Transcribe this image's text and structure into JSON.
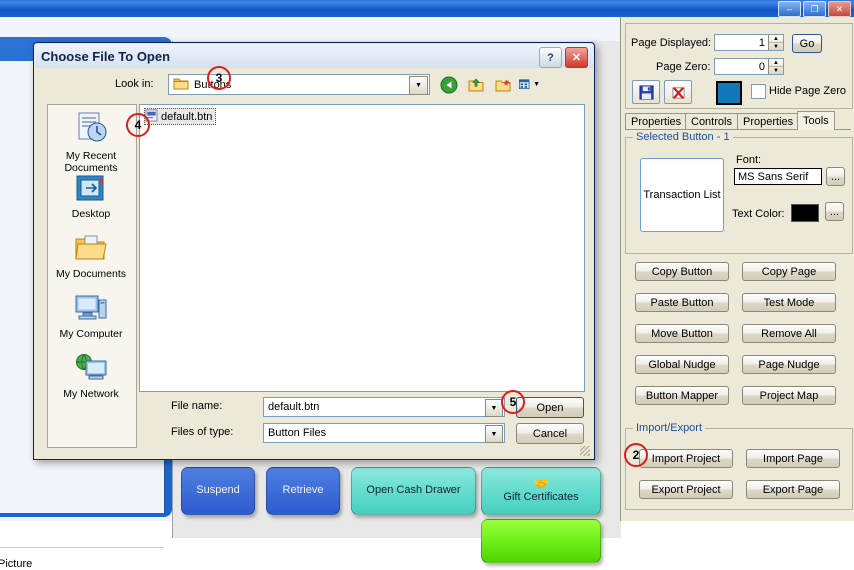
{
  "background_window": {
    "picture_label": "Picture",
    "window_buttons": [
      {
        "name": "minimize",
        "glyph": "–"
      },
      {
        "name": "maximize",
        "glyph": "❐"
      },
      {
        "name": "close",
        "glyph": "✕"
      }
    ],
    "pos_buttons": [
      {
        "label": "Suspend",
        "color": "blue"
      },
      {
        "label": "Retrieve",
        "color": "blue"
      },
      {
        "label": "Open Cash Drawer",
        "color": "teal"
      },
      {
        "label": "Gift Certificates",
        "color": "teal",
        "icon": "🤝"
      },
      {
        "label": "",
        "color": "green"
      }
    ]
  },
  "right_panel": {
    "page_displayed_label": "Page Displayed:",
    "page_displayed_value": "1",
    "page_zero_label": "Page Zero:",
    "page_zero_value": "0",
    "go_label": "Go",
    "save_icon": "💾",
    "delete_icon": "✖",
    "page_color": "#1378b8",
    "hide_page_zero_label": "Hide Page Zero",
    "hide_page_zero_checked": false,
    "tabs": [
      {
        "label": "Properties",
        "active": false
      },
      {
        "label": "Controls",
        "active": false
      },
      {
        "label": "Properties",
        "active": false
      },
      {
        "label": "Tools",
        "active": true
      }
    ],
    "selected_button_group": {
      "title": "Selected Button - 1",
      "preview_label": "Transaction List",
      "font_label": "Font:",
      "font_value": "MS Sans Serif",
      "font_browse": "...",
      "text_color_label": "Text Color:",
      "text_color_value": "#000000",
      "text_color_browse": "..."
    },
    "action_buttons": [
      {
        "label": "Copy Button"
      },
      {
        "label": "Copy Page"
      },
      {
        "label": "Paste Button"
      },
      {
        "label": "Test Mode"
      },
      {
        "label": "Move Button"
      },
      {
        "label": "Remove All"
      },
      {
        "label": "Global Nudge"
      },
      {
        "label": "Page Nudge"
      },
      {
        "label": "Button Mapper"
      },
      {
        "label": "Project Map"
      }
    ],
    "import_export_group": {
      "title": "Import/Export",
      "buttons": [
        {
          "label": "Import Project"
        },
        {
          "label": "Import Page"
        },
        {
          "label": "Export Project"
        },
        {
          "label": "Export Page"
        }
      ]
    }
  },
  "dialog": {
    "title": "Choose File To Open",
    "help_glyph": "?",
    "close_glyph": "✕",
    "look_in_label": "Look in:",
    "look_in_value": "Buttons",
    "toolbar_icons": [
      "back-icon",
      "up-one-level-icon",
      "new-folder-icon",
      "views-icon"
    ],
    "places": [
      {
        "label": "My Recent Documents"
      },
      {
        "label": "Desktop"
      },
      {
        "label": "My Documents"
      },
      {
        "label": "My Computer"
      },
      {
        "label": "My Network"
      }
    ],
    "files": [
      {
        "name": "default.btn",
        "selected": true
      }
    ],
    "file_name_label": "File name:",
    "file_name_value": "default.btn",
    "files_of_type_label": "Files of type:",
    "files_of_type_value": "Button Files",
    "open_label": "Open",
    "cancel_label": "Cancel"
  },
  "annotations": [
    {
      "number": "2"
    },
    {
      "number": "3"
    },
    {
      "number": "4"
    },
    {
      "number": "5"
    }
  ]
}
